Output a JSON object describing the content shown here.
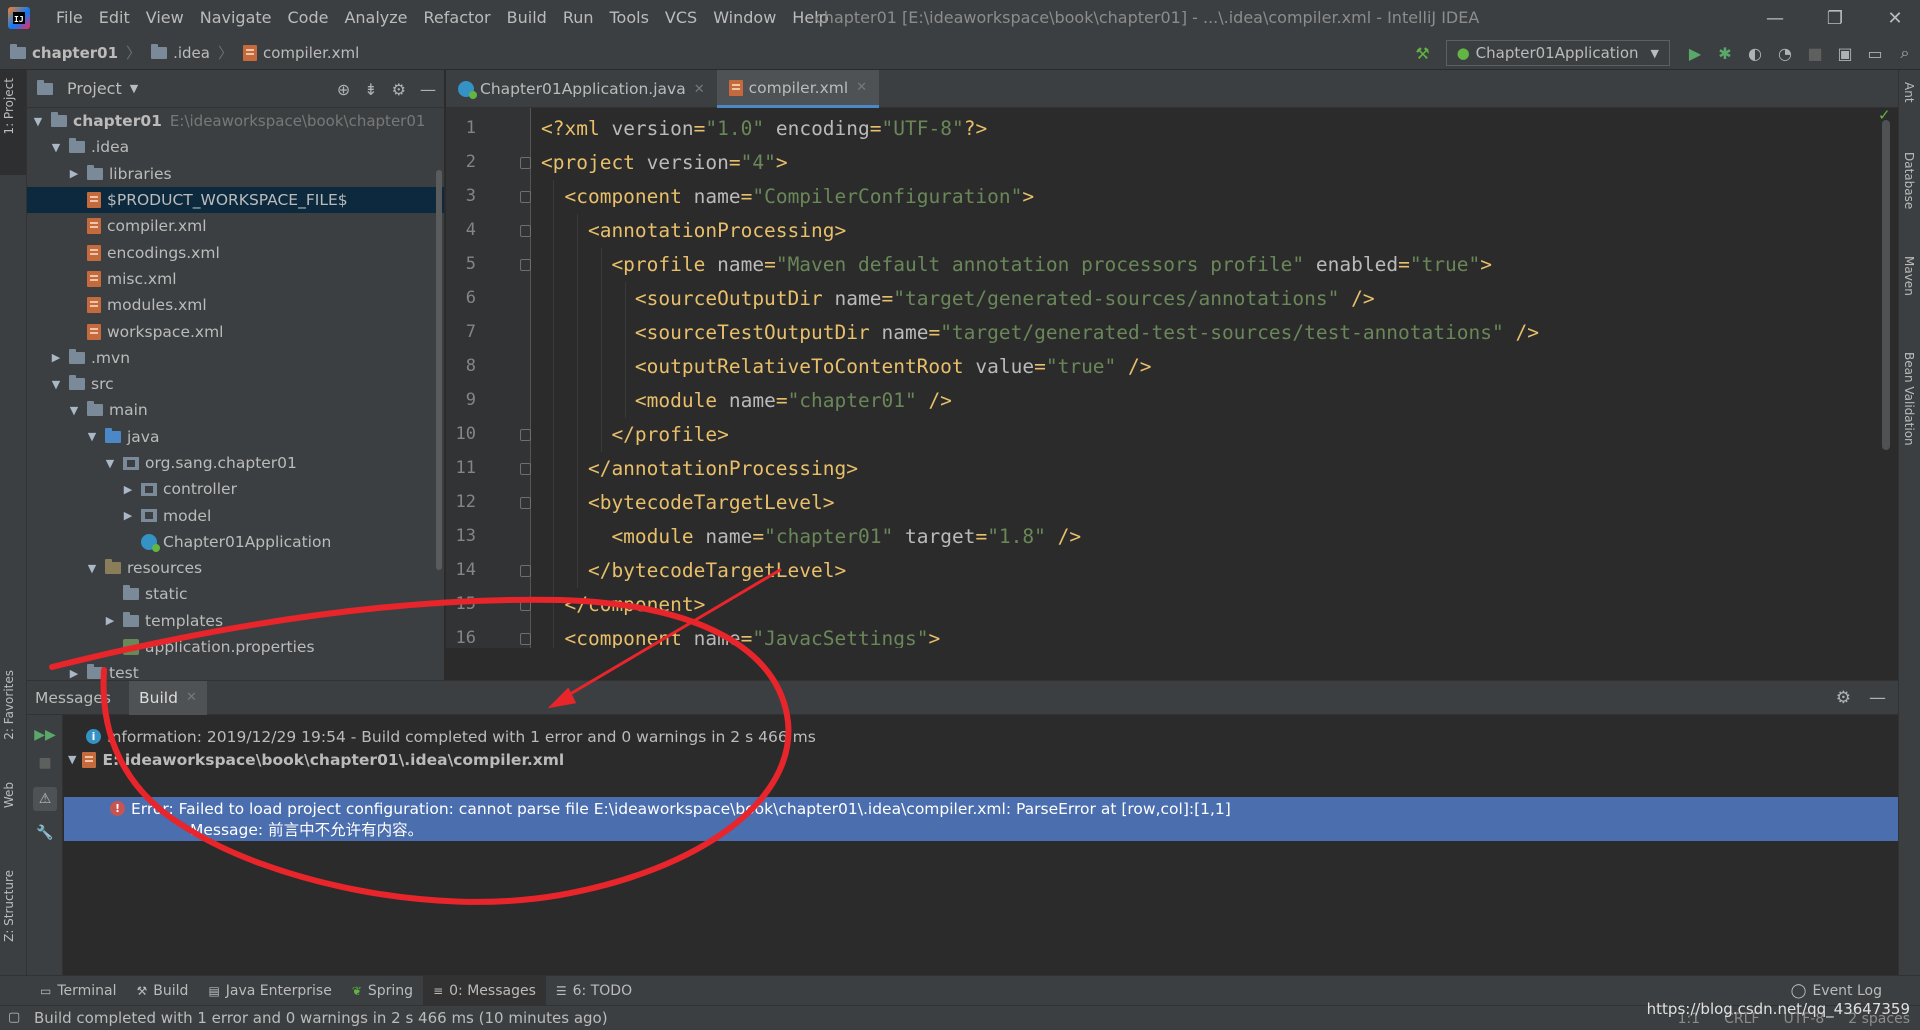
{
  "menu": [
    "File",
    "Edit",
    "View",
    "Navigate",
    "Code",
    "Analyze",
    "Refactor",
    "Build",
    "Run",
    "Tools",
    "VCS",
    "Window",
    "Help"
  ],
  "window_title": "chapter01 [E:\\ideaworkspace\\book\\chapter01] - ...\\.idea\\compiler.xml - IntelliJ IDEA",
  "breadcrumbs": [
    "chapter01",
    ".idea",
    "compiler.xml"
  ],
  "run_config": "Chapter01Application",
  "left_stripe": {
    "project": "1: Project",
    "favorites": "2: Favorites",
    "web": "Web",
    "structure": "Z: Structure"
  },
  "right_stripe": [
    "Ant",
    "Database",
    "Maven",
    "Bean Validation"
  ],
  "project_panel": {
    "title": "Project",
    "root_name": "chapter01",
    "root_path": "E:\\ideaworkspace\\book\\chapter01",
    "items": [
      ".idea",
      "libraries",
      "$PRODUCT_WORKSPACE_FILE$",
      "compiler.xml",
      "encodings.xml",
      "misc.xml",
      "modules.xml",
      "workspace.xml",
      ".mvn",
      "src",
      "main",
      "java",
      "org.sang.chapter01",
      "controller",
      "model",
      "Chapter01Application",
      "resources",
      "static",
      "templates",
      "application.properties",
      "test"
    ]
  },
  "editor": {
    "tabs": [
      "Chapter01Application.java",
      "compiler.xml"
    ],
    "lines": [
      [
        [
          "plain",
          "<?xml "
        ],
        [
          "attr",
          "version"
        ],
        [
          "plain",
          "="
        ],
        [
          "val",
          "\"1.0\""
        ],
        [
          "plain",
          " "
        ],
        [
          "attr",
          "encoding"
        ],
        [
          "plain",
          "="
        ],
        [
          "val",
          "\"UTF-8\""
        ],
        [
          "plain",
          "?>"
        ]
      ],
      [
        [
          "tag",
          "<project "
        ],
        [
          "attr",
          "version"
        ],
        [
          "tag",
          "="
        ],
        [
          "val",
          "\"4\""
        ],
        [
          "tag",
          ">"
        ]
      ],
      [
        [
          "tag",
          "  <component "
        ],
        [
          "attr",
          "name"
        ],
        [
          "tag",
          "="
        ],
        [
          "val",
          "\"CompilerConfiguration\""
        ],
        [
          "tag",
          ">"
        ]
      ],
      [
        [
          "tag",
          "    <annotationProcessing>"
        ]
      ],
      [
        [
          "tag",
          "      <profile "
        ],
        [
          "attr",
          "name"
        ],
        [
          "tag",
          "="
        ],
        [
          "val",
          "\"Maven default annotation processors profile\""
        ],
        [
          "tag",
          " "
        ],
        [
          "attr",
          "enabled"
        ],
        [
          "tag",
          "="
        ],
        [
          "val",
          "\"true\""
        ],
        [
          "tag",
          ">"
        ]
      ],
      [
        [
          "tag",
          "        <sourceOutputDir "
        ],
        [
          "attr",
          "name"
        ],
        [
          "tag",
          "="
        ],
        [
          "val",
          "\"target/generated-sources/annotations\""
        ],
        [
          "tag",
          " />"
        ]
      ],
      [
        [
          "tag",
          "        <sourceTestOutputDir "
        ],
        [
          "attr",
          "name"
        ],
        [
          "tag",
          "="
        ],
        [
          "val",
          "\"target/generated-test-sources/test-annotations\""
        ],
        [
          "tag",
          " />"
        ]
      ],
      [
        [
          "tag",
          "        <outputRelativeToContentRoot "
        ],
        [
          "attr",
          "value"
        ],
        [
          "tag",
          "="
        ],
        [
          "val",
          "\"true\""
        ],
        [
          "tag",
          " />"
        ]
      ],
      [
        [
          "tag",
          "        <module "
        ],
        [
          "attr",
          "name"
        ],
        [
          "tag",
          "="
        ],
        [
          "val",
          "\"chapter01\""
        ],
        [
          "tag",
          " />"
        ]
      ],
      [
        [
          "tag",
          "      </profile>"
        ]
      ],
      [
        [
          "tag",
          "    </annotationProcessing>"
        ]
      ],
      [
        [
          "tag",
          "    <bytecodeTargetLevel>"
        ]
      ],
      [
        [
          "tag",
          "      <module "
        ],
        [
          "attr",
          "name"
        ],
        [
          "tag",
          "="
        ],
        [
          "val",
          "\"chapter01\""
        ],
        [
          "tag",
          " "
        ],
        [
          "attr",
          "target"
        ],
        [
          "tag",
          "="
        ],
        [
          "val",
          "\"1.8\""
        ],
        [
          "tag",
          " />"
        ]
      ],
      [
        [
          "tag",
          "    </bytecodeTargetLevel>"
        ]
      ],
      [
        [
          "tag",
          "  </component>"
        ]
      ],
      [
        [
          "tag",
          "  <component "
        ],
        [
          "attr",
          "name"
        ],
        [
          "tag",
          "="
        ],
        [
          "val",
          "\"JavacSettings\""
        ],
        [
          "tag",
          ">"
        ]
      ]
    ]
  },
  "bottom_panel": {
    "messages_label": "Messages",
    "build_tab": "Build",
    "info": "Information: 2019/12/29 19:54 - Build completed with 1 error and 0 warnings in 2 s 466 ms",
    "file": "E:\\ideaworkspace\\book\\chapter01\\.idea\\compiler.xml",
    "error": "Error: Failed to load project configuration: cannot parse file E:\\ideaworkspace\\book\\chapter01\\.idea\\compiler.xml: ParseError at [row,col]:[1,1]",
    "error_message": "Message: 前言中不允许有内容。"
  },
  "tool_windows": [
    "Terminal",
    "Build",
    "Java Enterprise",
    "Spring",
    "0: Messages",
    "6: TODO"
  ],
  "event_log": "Event Log",
  "status": {
    "text": "Build completed with 1 error and 0 warnings in 2 s 466 ms (10 minutes ago)",
    "position": "1:1",
    "line_sep": "CRLF",
    "encoding": "UTF-8",
    "indent": "2 spaces"
  },
  "watermark": "https://blog.csdn.net/qq_43647359",
  "colors": {
    "bg": "#2b2b2b",
    "panel": "#3c3f41",
    "selection": "#4b6eaf",
    "tag": "#e8bf6a",
    "value": "#6a8759",
    "annotation": "#e8252a"
  }
}
